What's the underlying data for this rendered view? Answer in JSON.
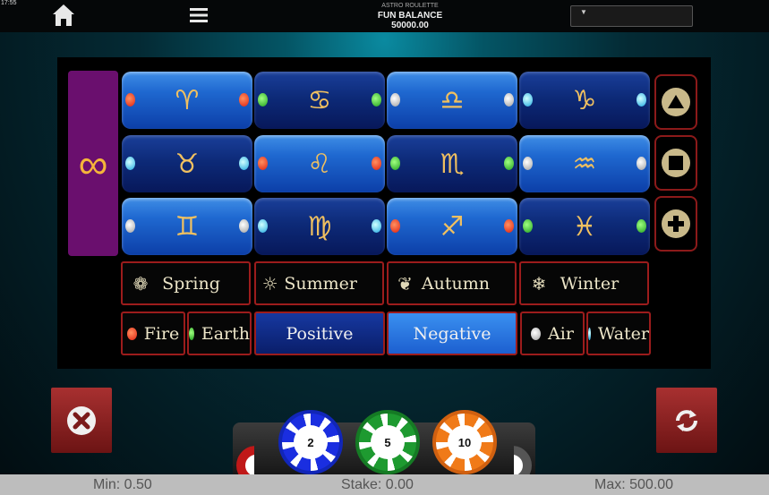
{
  "top": {
    "clock": "17:55",
    "balance_title": "ASTRO ROULETTE",
    "balance_label": "FUN BALANCE",
    "balance_value": "50000.00",
    "icons": {
      "home": "home-icon",
      "menu": "hamburger-menu-icon",
      "dropdown": "chevron-down-icon"
    }
  },
  "board": {
    "infinity_symbol": "∞",
    "rows": [
      [
        {
          "glyph": "♈",
          "style": "light",
          "left": "red",
          "right": "red"
        },
        {
          "glyph": "♋",
          "style": "dark",
          "left": "green",
          "right": "green"
        },
        {
          "glyph": "♎",
          "style": "light",
          "left": "white",
          "right": "white"
        },
        {
          "glyph": "♑",
          "style": "dark",
          "left": "blue",
          "right": "blue"
        }
      ],
      [
        {
          "glyph": "♉",
          "style": "dark",
          "left": "blue",
          "right": "blue"
        },
        {
          "glyph": "♌",
          "style": "light",
          "left": "red",
          "right": "red"
        },
        {
          "glyph": "♏",
          "style": "dark",
          "left": "green",
          "right": "green"
        },
        {
          "glyph": "♒",
          "style": "light",
          "left": "white",
          "right": "white"
        }
      ],
      [
        {
          "glyph": "♊",
          "style": "light",
          "left": "white",
          "right": "white"
        },
        {
          "glyph": "♍",
          "style": "dark",
          "left": "blue",
          "right": "blue"
        },
        {
          "glyph": "♐",
          "style": "light",
          "left": "red",
          "right": "red"
        },
        {
          "glyph": "♓",
          "style": "dark",
          "left": "green",
          "right": "green"
        }
      ]
    ],
    "side_buttons": [
      "arrow-up-icon",
      "square-icon",
      "plus-icon"
    ],
    "seasons": [
      {
        "label": "Spring",
        "icon": "❁"
      },
      {
        "label": "Summer",
        "icon": "☼"
      },
      {
        "label": "Autumn",
        "icon": "❦"
      },
      {
        "label": "Winter",
        "icon": "❄"
      }
    ],
    "bets": {
      "fire": "Fire",
      "earth": "Earth",
      "positive": "Positive",
      "negative": "Negative",
      "air": "Air",
      "water": "Water"
    }
  },
  "chips": [
    "2",
    "5",
    "10"
  ],
  "footer": {
    "min": "Min: 0.50",
    "stake": "Stake: 0.00",
    "max": "Max: 500.00"
  },
  "colors": {
    "board_bg": "#000000",
    "infinity_panel": "#6a0f6e",
    "border_red": "#9c1c1c",
    "chip_blue": "#1a2ee0",
    "chip_green": "#1e9a30",
    "chip_orange": "#f07a18"
  }
}
